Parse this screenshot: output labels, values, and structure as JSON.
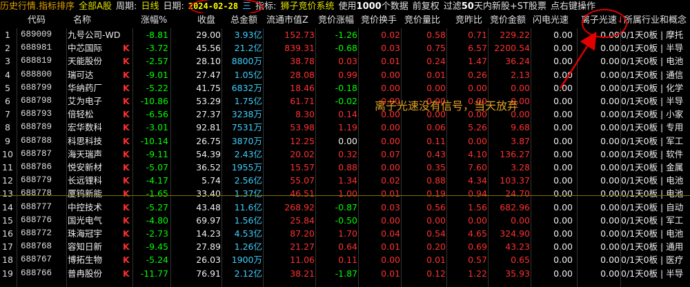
{
  "topbar": {
    "title": "历史行情.指标排序",
    "scope": "全部A股",
    "period_label": "周期:",
    "period_value": "日线",
    "date_label": "日期:",
    "date_value": "2024-02-28",
    "date_suffix": "三",
    "indicator_label": "指标:",
    "indicator_value": "狮子竞价系统",
    "use_label": "使用",
    "data_count": "1000",
    "data_unit": "个数据",
    "adjust": "前复权",
    "filter_prefix": "过滤",
    "filter_days": "50",
    "filter_suffix": "天内新股+ST股票",
    "right_click": "点右键操作"
  },
  "headers": {
    "code": "代码",
    "name": "名称",
    "change": "涨幅%",
    "close": "收盘",
    "amount": "总金额",
    "float_cap": "流通市值Z",
    "bid_change": "竞价涨幅",
    "bid_turnover": "竞价换手",
    "bid_volume_ratio": "竞价量比",
    "bid_ratio": "竞昨比",
    "bid_amount": "竞价金额",
    "flash": "闪电光速",
    "ion_speed": "离子光速",
    "sort_arrow": "↓",
    "industry": "所属行业和概念"
  },
  "annotation": "离子光速没有信号，当天放弃",
  "colors": {
    "up": "#ff3030",
    "down": "#00ff00",
    "neutral": "#f0f0f0",
    "accent_cyan": "#40d0ff",
    "highlight_ring": "#e00000"
  },
  "rows": [
    {
      "idx": "1",
      "code": "689009",
      "name": "九号公司-WD",
      "k": "",
      "chg": "-8.81",
      "close": "29.00",
      "amt": "3.93亿",
      "float": "152.73",
      "bidchg": "-1.26",
      "turn": "0.02",
      "vr": "0.58",
      "ratio": "0.71",
      "bidamt": "229.22",
      "flash": "0.00",
      "ion": "0.00",
      "ind": "0/1天0板 | 摩托"
    },
    {
      "idx": "2",
      "code": "688981",
      "name": "中芯国际",
      "k": "K",
      "chg": "-3.72",
      "close": "45.56",
      "amt": "21.2亿",
      "float": "839.31",
      "bidchg": "-0.68",
      "turn": "0.03",
      "vr": "0.75",
      "ratio": "6.57",
      "bidamt": "2200.54",
      "flash": "0.00",
      "ion": "0.00",
      "ind": "0/1天0板 | 半导"
    },
    {
      "idx": "3",
      "code": "688819",
      "name": "天能股份",
      "k": "K",
      "chg": "-2.57",
      "close": "28.10",
      "amt": "8800万",
      "float": "38.78",
      "bidchg": "0.03",
      "turn": "0.01",
      "vr": "0.24",
      "ratio": "1.47",
      "bidamt": "36.24",
      "flash": "0.00",
      "ion": "0.00",
      "ind": "0/1天0板 | 电池"
    },
    {
      "idx": "4",
      "code": "688800",
      "name": "瑞可达",
      "k": "K",
      "chg": "-9.01",
      "close": "27.47",
      "amt": "1.05亿",
      "float": "28.08",
      "bidchg": "0.99",
      "turn": "0.00",
      "vr": "0.01",
      "ratio": "0.26",
      "bidamt": "2.13",
      "flash": "0.00",
      "ion": "0.00",
      "ind": "0/1天0板 | 通信"
    },
    {
      "idx": "5",
      "code": "688799",
      "name": "华纳药厂",
      "k": "K",
      "chg": "-5.22",
      "close": "41.75",
      "amt": "6832万",
      "float": "18.46",
      "bidchg": "-0.18",
      "turn": "0.00",
      "vr": "0.00",
      "ratio": "0.00",
      "bidamt": "0.00",
      "flash": "0.00",
      "ion": "0.00",
      "ind": "0/1天0板 | 化学"
    },
    {
      "idx": "6",
      "code": "688798",
      "name": "艾为电子",
      "k": "K",
      "chg": "-10.86",
      "close": "53.29",
      "amt": "1.75亿",
      "float": "61.71",
      "bidchg": "-0.02",
      "turn": "0.00",
      "vr": "0.00",
      "ratio": "0.00",
      "bidamt": "0.00",
      "flash": "0.00",
      "ion": "0.00",
      "ind": "0/1天0板 | 半导"
    },
    {
      "idx": "7",
      "code": "688793",
      "name": "倍轻松",
      "k": "K",
      "chg": "-6.56",
      "close": "27.37",
      "amt": "3238万",
      "float": "8.30",
      "bidchg": "0.14",
      "turn": "0.00",
      "vr": "0.00",
      "ratio": "0.00",
      "bidamt": "0.00",
      "flash": "0.00",
      "ion": "0.00",
      "ind": "0/1天0板 | 小家"
    },
    {
      "idx": "8",
      "code": "688789",
      "name": "宏华数科",
      "k": "K",
      "chg": "-3.01",
      "close": "92.81",
      "amt": "7531万",
      "float": "53.98",
      "bidchg": "1.19",
      "turn": "0.00",
      "vr": "0.06",
      "ratio": "5.26",
      "bidamt": "9.68",
      "flash": "0.00",
      "ion": "0.00",
      "ind": "0/1天0板 | 专用"
    },
    {
      "idx": "9",
      "code": "688788",
      "name": "科思科技",
      "k": "K",
      "chg": "-10.14",
      "close": "26.75",
      "amt": "3870万",
      "float": "12.25",
      "bidchg": "0.00",
      "turn": "0.00",
      "vr": "0.11",
      "ratio": "0.00",
      "bidamt": "3.87",
      "flash": "0.00",
      "ion": "0.00",
      "ind": "0/1天0板 | 军工"
    },
    {
      "idx": "10",
      "code": "688787",
      "name": "海天瑞声",
      "k": "K",
      "chg": "-9.11",
      "close": "54.39",
      "amt": "2.43亿",
      "float": "20.02",
      "bidchg": "0.32",
      "turn": "0.07",
      "vr": "0.43",
      "ratio": "4.10",
      "bidamt": "136.27",
      "flash": "0.00",
      "ion": "0.00",
      "ind": "0/1天0板 | 软件"
    },
    {
      "idx": "11",
      "code": "688786",
      "name": "悦安新材",
      "k": "K",
      "chg": "-5.07",
      "close": "36.52",
      "amt": "1955万",
      "float": "15.57",
      "bidchg": "0.88",
      "turn": "0.00",
      "vr": "0.35",
      "ratio": "7.60",
      "bidamt": "3.28",
      "flash": "0.00",
      "ion": "0.00",
      "ind": "0/1天0板 | 金属"
    },
    {
      "idx": "12",
      "code": "688779",
      "name": "长远锂科",
      "k": "K",
      "chg": "-4.17",
      "close": "5.74",
      "amt": "2.56亿",
      "float": "55.07",
      "bidchg": "1.34",
      "turn": "0.02",
      "vr": "0.88",
      "ratio": "4.34",
      "bidamt": "103.37",
      "flash": "0.00",
      "ion": "0.00",
      "ind": "0/1天0板 | 电池"
    },
    {
      "idx": "13",
      "code": "688778",
      "name": "厦钨新能",
      "k": "K",
      "chg": "-1.65",
      "close": "33.40",
      "amt": "1.37亿",
      "float": "46.51",
      "bidchg": "1.00",
      "turn": "0.01",
      "vr": "0.19",
      "ratio": "0.94",
      "bidamt": "24.70",
      "flash": "0.00",
      "ion": "0.00",
      "ind": "0/1天0板 | 电池"
    },
    {
      "idx": "14",
      "code": "688777",
      "name": "中控技术",
      "k": "K",
      "chg": "-5.27",
      "close": "43.48",
      "amt": "11.6亿",
      "float": "268.92",
      "bidchg": "-0.87",
      "turn": "0.03",
      "vr": "0.56",
      "ratio": "1.56",
      "bidamt": "682.96",
      "flash": "0.00",
      "ion": "0.00",
      "ind": "0/1天0板 | 自动"
    },
    {
      "idx": "15",
      "code": "688776",
      "name": "国光电气",
      "k": "K",
      "chg": "-4.80",
      "close": "69.97",
      "amt": "1.56亿",
      "float": "25.84",
      "bidchg": "-0.50",
      "turn": "0.00",
      "vr": "0.00",
      "ratio": "0.00",
      "bidamt": "0.00",
      "flash": "0.00",
      "ion": "0.00",
      "ind": "0/1天0板 | 军工"
    },
    {
      "idx": "16",
      "code": "688772",
      "name": "珠海冠宇",
      "k": "K",
      "chg": "-2.73",
      "close": "14.23",
      "amt": "4.53亿",
      "float": "87.20",
      "bidchg": "1.70",
      "turn": "0.04",
      "vr": "0.54",
      "ratio": "4.65",
      "bidamt": "324.90",
      "flash": "0.00",
      "ion": "0.00",
      "ind": "0/1天0板 | 电池"
    },
    {
      "idx": "17",
      "code": "688768",
      "name": "容知日新",
      "k": "K",
      "chg": "-9.45",
      "close": "27.89",
      "amt": "1.26亿",
      "float": "21.27",
      "bidchg": "0.64",
      "turn": "0.01",
      "vr": "0.20",
      "ratio": "0.69",
      "bidamt": "43.23",
      "flash": "0.00",
      "ion": "0.00",
      "ind": "0/1天0板 | 通用"
    },
    {
      "idx": "18",
      "code": "688767",
      "name": "博拓生物",
      "k": "K",
      "chg": "-5.24",
      "close": "26.03",
      "amt": "1900万",
      "float": "11.06",
      "bidchg": "0.11",
      "turn": "0.00",
      "vr": "0.01",
      "ratio": "0.57",
      "bidamt": "0.65",
      "flash": "0.00",
      "ion": "0.00",
      "ind": "0/1天0板 | 医疗"
    },
    {
      "idx": "19",
      "code": "688766",
      "name": "普冉股份",
      "k": "K",
      "chg": "-11.77",
      "close": "76.91",
      "amt": "2.12亿",
      "float": "38.21",
      "bidchg": "-1.87",
      "turn": "0.01",
      "vr": "0.12",
      "ratio": "1.22",
      "bidamt": "35.93",
      "flash": "0.00",
      "ion": "0.00",
      "ind": "0/1天0板 | 半导"
    }
  ]
}
